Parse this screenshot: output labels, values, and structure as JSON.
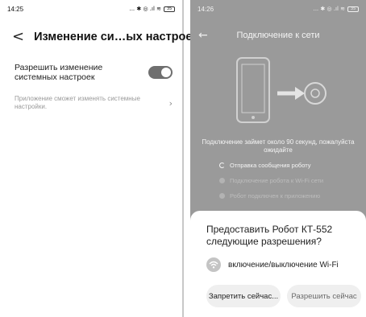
{
  "left": {
    "status": {
      "time": "14:25",
      "icons": "... ✱ ◎ .ıl ≋",
      "battery": "35"
    },
    "header": {
      "title": "Изменение си…ых настроек"
    },
    "setting": {
      "label": "Разрешить изменение системных настроек",
      "enabled": true
    },
    "description": "Приложение сможет изменять системные настройки."
  },
  "right": {
    "status": {
      "time": "14:26",
      "icons": "... ✱ ◎ .ıl ≋",
      "battery": "35"
    },
    "header": {
      "title": "Подключение к сети"
    },
    "wait_text": "Подключение займет около 90 секунд, пожалуйста ожидайте",
    "steps": [
      {
        "label": "Отправка сообщения роботу",
        "state": "active"
      },
      {
        "label": "Подключение робота к Wi-Fi сети",
        "state": "pending"
      },
      {
        "label": "Робот подключен к приложению",
        "state": "pending"
      }
    ],
    "sheet": {
      "question": "Предоставить Робот КТ-552 следующие разрешения?",
      "permission": "включение/выключение Wi-Fi",
      "deny_label": "Запретить сейчас...",
      "allow_label": "Разрешить сейчас"
    }
  },
  "colors": {
    "toggle_on": "#6f6f6f",
    "dim_overlay": "#9a9a9a",
    "sheet_bg": "#ffffff"
  }
}
